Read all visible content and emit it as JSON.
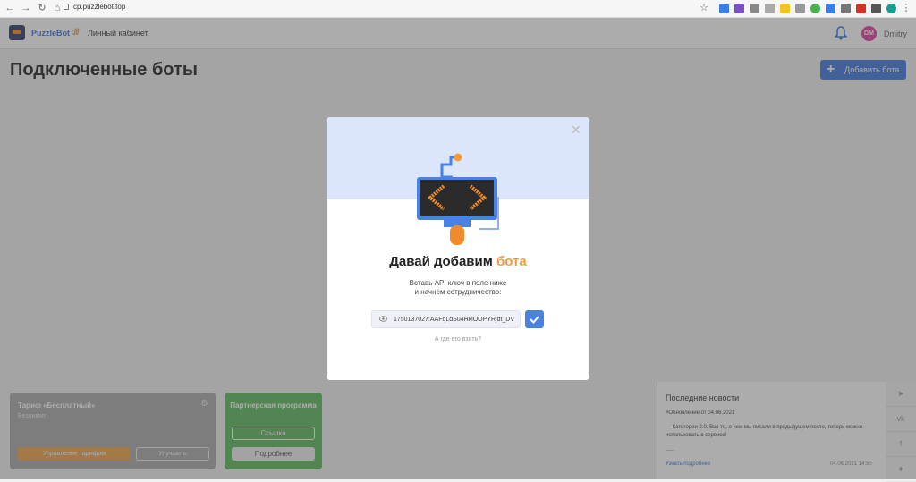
{
  "browser": {
    "url": "cp.puzzlebot.top"
  },
  "header": {
    "brand": "PuzzleBot",
    "separator": ":///",
    "section": "Личный кабинет",
    "avatar_initials": "DM",
    "username": "Dmitry"
  },
  "page": {
    "title": "Подключенные боты",
    "add_bot_label": "Добавить бота"
  },
  "tariff": {
    "title": "Тариф «Бесплатный»",
    "subtitle": "Безлимит",
    "manage_label": "Управление тарифом",
    "upgrade_label": "Улучшить"
  },
  "partner": {
    "title": "Партнерская программа",
    "link_label": "Ссылка",
    "details_label": "Подробнее"
  },
  "news": {
    "heading": "Последние новости",
    "tag": "#Обновление от 04.06.2021",
    "text": "— Категории 2.0. Всё то, о чем мы писали в предыдущем посте, теперь можно использовать в сервисе!",
    "dots": "......",
    "more_label": "Узнать подробнее",
    "date": "04.06.2021 14:50"
  },
  "modal": {
    "title_main": "Давай добавим",
    "title_accent": "бота",
    "desc_line1": "Вставь API ключ в поле ниже",
    "desc_line2": "и начнем сотрудничество:",
    "token_value": "1750137027:AAFqLdSu4HklOOPYRjdt_DV",
    "where_label": "А где его взять?"
  },
  "colors": {
    "accent": "#3f77de",
    "orange": "#f59a3b",
    "green": "#5cb85c"
  }
}
